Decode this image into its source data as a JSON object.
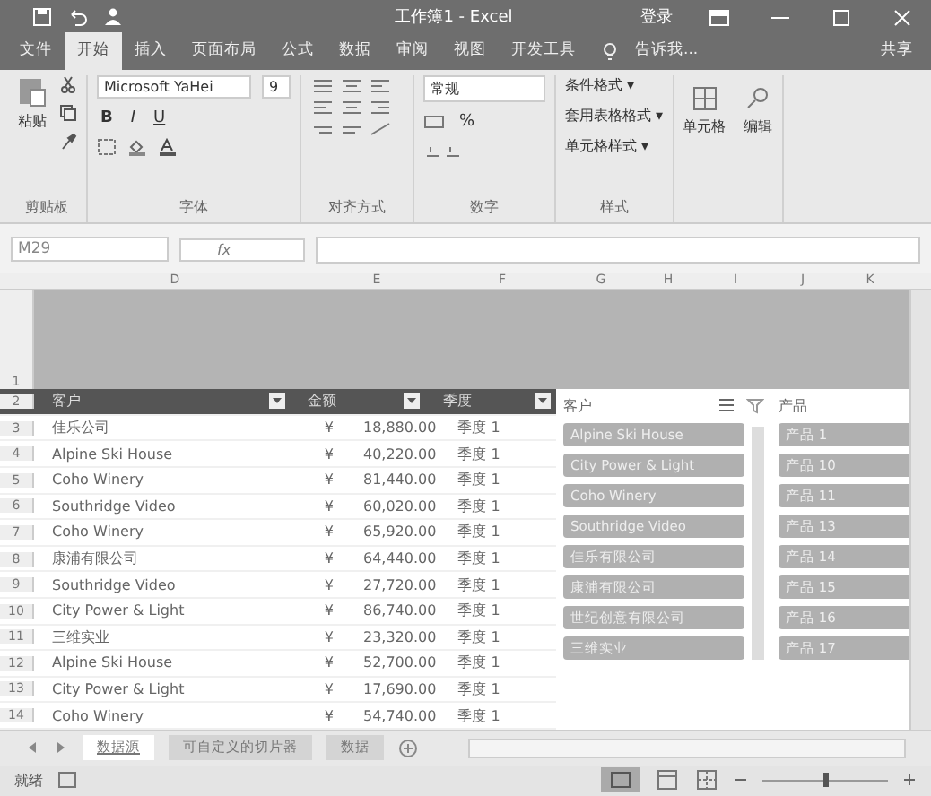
{
  "window": {
    "title": "工作簿1 - Excel",
    "login": "登录"
  },
  "menu_tabs": [
    {
      "label": "文件",
      "selected": false
    },
    {
      "label": "开始",
      "selected": true
    },
    {
      "label": "插入",
      "selected": false
    },
    {
      "label": "页面布局",
      "selected": false
    },
    {
      "label": "公式",
      "selected": false
    },
    {
      "label": "数据",
      "selected": false
    },
    {
      "label": "审阅",
      "selected": false
    },
    {
      "label": "视图",
      "selected": false
    },
    {
      "label": "开发工具",
      "selected": false
    }
  ],
  "tell_me": "告诉我...",
  "share": "共享",
  "ribbon": {
    "paste": "粘贴",
    "clipboard_label": "剪贴板",
    "font_name": "Microsoft YaHei",
    "font_size": "9",
    "bold": "B",
    "italic": "I",
    "underline": "U",
    "font_label": "字体",
    "alignment_label": "对齐方式",
    "number_format": "常规",
    "percent": "%",
    "number_label": "数字",
    "style_items": [
      "条件格式 ▾",
      "套用表格格式 ▾",
      "单元格样式 ▾"
    ],
    "styles_label": "样式",
    "cells": "单元格",
    "editing": "编辑"
  },
  "formula_bar": {
    "name_box": "M29",
    "fx": "fx"
  },
  "zoom": {
    "level": 0.5
  },
  "band_row": "1",
  "header_row": "2",
  "columns": [
    "D",
    "E",
    "F",
    "G",
    "H",
    "I",
    "J",
    "K"
  ],
  "table": {
    "headers": [
      "客户",
      "金额",
      "季度"
    ],
    "rows": [
      {
        "row": "3",
        "customer": "佳乐公司",
        "currency": "¥",
        "amount": "18,880.00",
        "quarter": "季度 1"
      },
      {
        "row": "4",
        "customer": "Alpine Ski House",
        "currency": "¥",
        "amount": "40,220.00",
        "quarter": "季度 1"
      },
      {
        "row": "5",
        "customer": "Coho Winery",
        "currency": "¥",
        "amount": "81,440.00",
        "quarter": "季度 1"
      },
      {
        "row": "6",
        "customer": "Southridge Video",
        "currency": "¥",
        "amount": "60,020.00",
        "quarter": "季度 1"
      },
      {
        "row": "7",
        "customer": "Coho Winery",
        "currency": "¥",
        "amount": "65,920.00",
        "quarter": "季度 1"
      },
      {
        "row": "8",
        "customer": "康浦有限公司",
        "currency": "¥",
        "amount": "64,440.00",
        "quarter": "季度 1"
      },
      {
        "row": "9",
        "customer": "Southridge Video",
        "currency": "¥",
        "amount": "27,720.00",
        "quarter": "季度 1"
      },
      {
        "row": "10",
        "customer": "City Power & Light",
        "currency": "¥",
        "amount": "86,740.00",
        "quarter": "季度 1"
      },
      {
        "row": "11",
        "customer": "三维实业",
        "currency": "¥",
        "amount": "23,320.00",
        "quarter": "季度 1"
      },
      {
        "row": "12",
        "customer": "Alpine Ski House",
        "currency": "¥",
        "amount": "52,700.00",
        "quarter": "季度 1"
      },
      {
        "row": "13",
        "customer": "City Power & Light",
        "currency": "¥",
        "amount": "17,690.00",
        "quarter": "季度 1"
      },
      {
        "row": "14",
        "customer": "Coho Winery",
        "currency": "¥",
        "amount": "54,740.00",
        "quarter": "季度 1"
      }
    ]
  },
  "slicers": [
    {
      "title": "客户",
      "items": [
        {
          "label": "Alpine Ski House",
          "selected": true
        },
        {
          "label": "City Power & Light",
          "selected": true
        },
        {
          "label": "Coho Winery",
          "selected": true
        },
        {
          "label": "Southridge Video",
          "selected": true
        },
        {
          "label": "佳乐有限公司",
          "selected": true
        },
        {
          "label": "康浦有限公司",
          "selected": true
        },
        {
          "label": "世纪创意有限公司",
          "selected": true
        },
        {
          "label": "三维实业",
          "selected": true
        }
      ]
    },
    {
      "title": "产品",
      "items": [
        {
          "label": "产品 1",
          "selected": true
        },
        {
          "label": "产品 10",
          "selected": true
        },
        {
          "label": "产品 11",
          "selected": true
        },
        {
          "label": "产品 13",
          "selected": true
        },
        {
          "label": "产品 14",
          "selected": true
        },
        {
          "label": "产品 15",
          "selected": true
        },
        {
          "label": "产品 16",
          "selected": true
        },
        {
          "label": "产品 17",
          "selected": true
        }
      ]
    }
  ],
  "sheet_tabs": [
    {
      "label": "数据源",
      "selected": true
    },
    {
      "label": "可自定义的切片器",
      "selected": false
    },
    {
      "label": "数据",
      "selected": false
    }
  ],
  "status": "就绪"
}
